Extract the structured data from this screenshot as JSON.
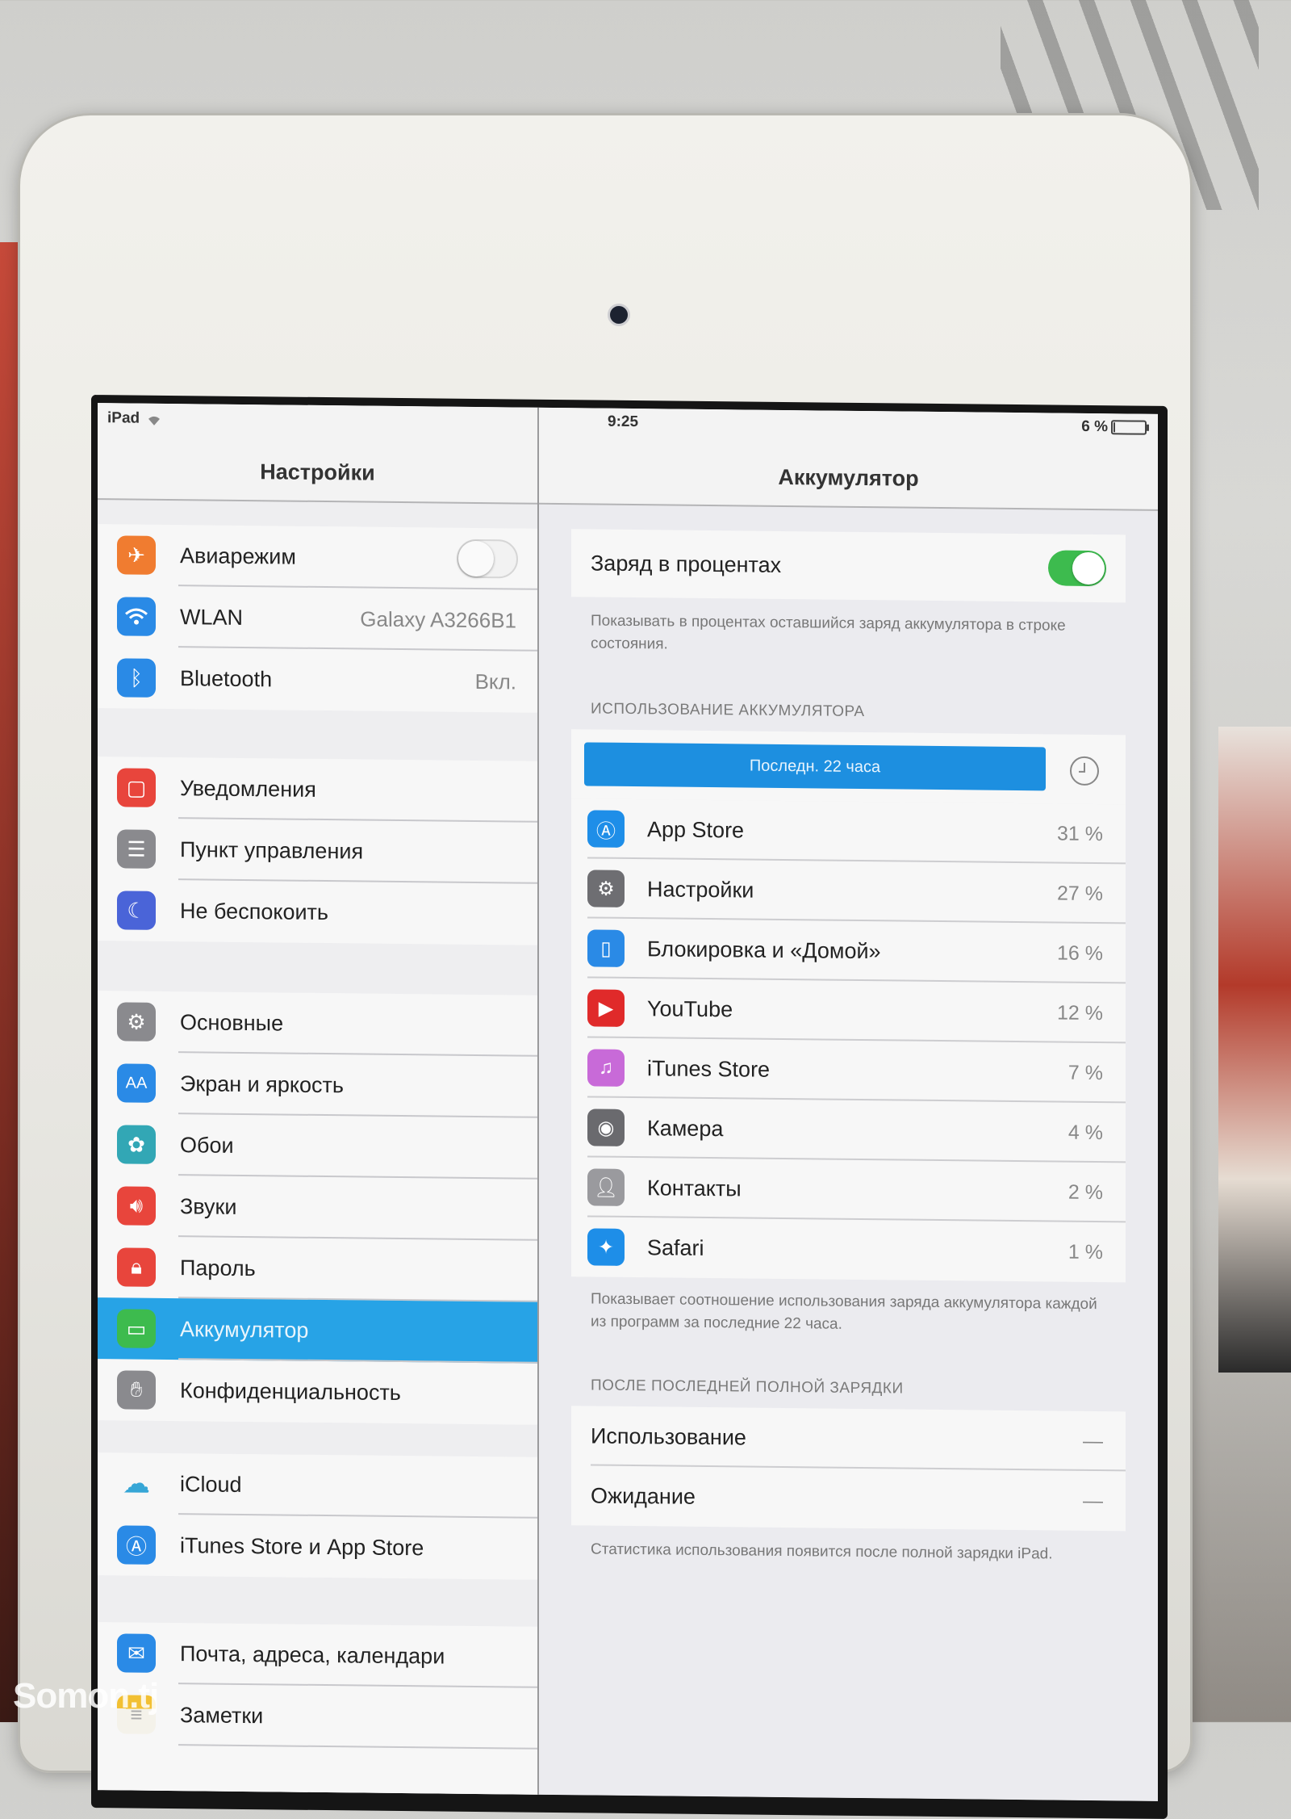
{
  "status_bar": {
    "device": "iPad",
    "time": "9:25",
    "battery_percent_text": "6 %",
    "battery_level": 0.06
  },
  "master": {
    "title": "Настройки",
    "groups": [
      [
        {
          "label": "Авиарежим",
          "icon": "airplane-icon",
          "color": "#f07c30",
          "toggle": "off"
        },
        {
          "label": "WLAN",
          "icon": "wifi-icon",
          "color": "#2a8ae6",
          "value": "Galaxy A3266B1"
        },
        {
          "label": "Bluetooth",
          "icon": "bluetooth-icon",
          "color": "#2a8ae6",
          "value": "Вкл."
        }
      ],
      [
        {
          "label": "Уведомления",
          "icon": "notifications-icon",
          "color": "#e8453c"
        },
        {
          "label": "Пункт управления",
          "icon": "control-center-icon",
          "color": "#8a8a8e"
        },
        {
          "label": "Не беспокоить",
          "icon": "moon-icon",
          "color": "#4a64d8"
        }
      ],
      [
        {
          "label": "Основные",
          "icon": "gear-icon",
          "color": "#8a8a8e"
        },
        {
          "label": "Экран и яркость",
          "icon": "display-brightness-icon",
          "color": "#2a8ae6"
        },
        {
          "label": "Обои",
          "icon": "wallpaper-icon",
          "color": "#32a7b5"
        },
        {
          "label": "Звуки",
          "icon": "speaker-icon",
          "color": "#e8453c"
        },
        {
          "label": "Пароль",
          "icon": "lock-icon",
          "color": "#e8453c"
        },
        {
          "label": "Аккумулятор",
          "icon": "battery-icon",
          "color": "#3dbb4e",
          "selected": true
        },
        {
          "label": "Конфиденциальность",
          "icon": "hand-icon",
          "color": "#8a8a8e"
        }
      ],
      [
        {
          "label": "iCloud",
          "icon": "cloud-icon",
          "color": "#36a6d6"
        },
        {
          "label": "iTunes Store и App Store",
          "icon": "app-store-icon",
          "color": "#2a8ae6"
        }
      ],
      [
        {
          "label": "Почта, адреса, календари",
          "icon": "mail-icon",
          "color": "#2a8ae6"
        },
        {
          "label": "Заметки",
          "icon": "notes-icon",
          "color": "#f2c033"
        }
      ]
    ]
  },
  "detail": {
    "title": "Аккумулятор",
    "percent_toggle": {
      "label": "Заряд в процентах",
      "state": "on"
    },
    "percent_footnote": "Показывать в процентах оставшийся заряд аккумулятора в строке состояния.",
    "usage_header": "ИСПОЛЬЗОВАНИЕ АККУМУЛЯТОРА",
    "usage_segment": "Последн. 22 часа",
    "apps": [
      {
        "name": "App Store",
        "percent": "31 %",
        "icon": "app-store-icon",
        "color": "#1e8ee8"
      },
      {
        "name": "Настройки",
        "percent": "27 %",
        "icon": "gear-icon",
        "color": "#6e6e72"
      },
      {
        "name": "Блокировка и «Домой»",
        "percent": "16 %",
        "icon": "home-lock-icon",
        "color": "#2a8ae6"
      },
      {
        "name": "YouTube",
        "percent": "12 %",
        "icon": "youtube-icon",
        "color": "#e02a2a"
      },
      {
        "name": "iTunes Store",
        "percent": "7 %",
        "icon": "music-note-icon",
        "color": "#c86ad8"
      },
      {
        "name": "Камера",
        "percent": "4 %",
        "icon": "camera-icon",
        "color": "#6a6a6e"
      },
      {
        "name": "Контакты",
        "percent": "2 %",
        "icon": "contacts-icon",
        "color": "#9a9a9e"
      },
      {
        "name": "Safari",
        "percent": "1 %",
        "icon": "compass-icon",
        "color": "#1e8ee8"
      }
    ],
    "usage_footnote": "Показывает соотношение использования заряда аккумулятора каждой из программ за последние 22 часа.",
    "since_charge_header": "ПОСЛЕ ПОСЛЕДНЕЙ ПОЛНОЙ ЗАРЯДКИ",
    "since_charge_rows": [
      {
        "label": "Использование",
        "value": "—"
      },
      {
        "label": "Ожидание",
        "value": "—"
      }
    ],
    "since_charge_footnote": "Статистика использования появится после полной зарядки iPad."
  },
  "watermark": "Somon.tj"
}
